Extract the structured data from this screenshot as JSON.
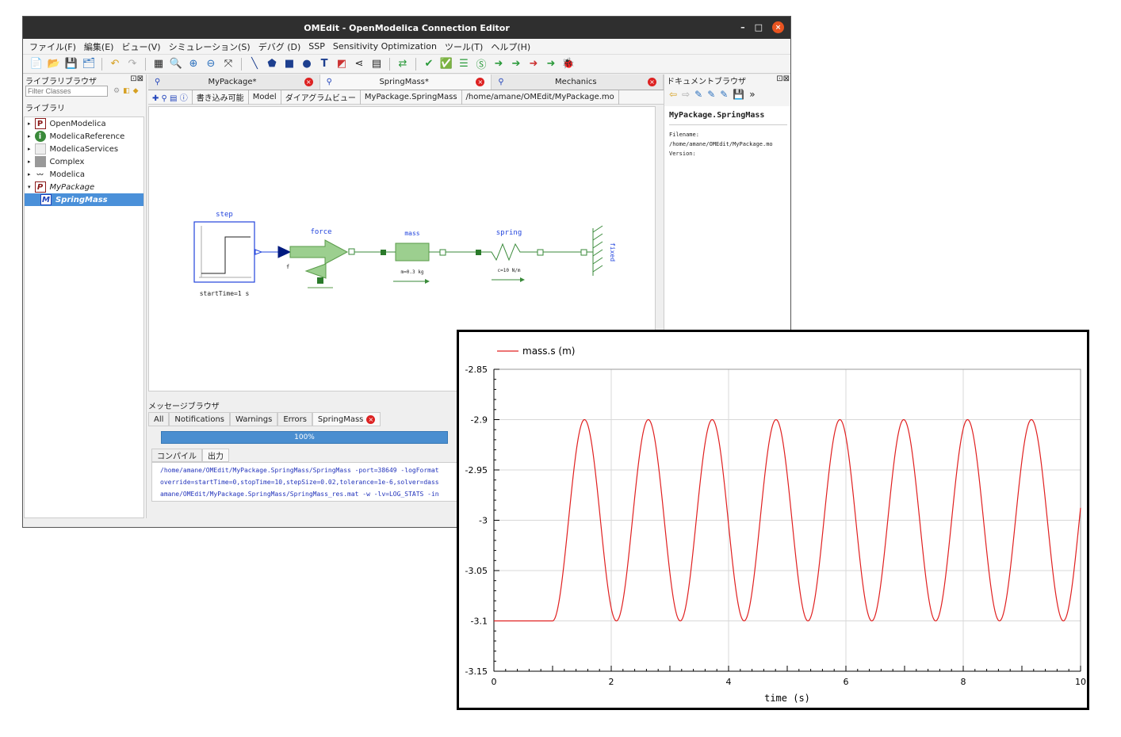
{
  "window": {
    "title": "OMEdit - OpenModelica Connection Editor",
    "min": "–",
    "max": "□",
    "close": "×"
  },
  "menu": [
    "ファイル(F)",
    "編集(E)",
    "ビュー(V)",
    "シミュレーション(S)",
    "デバグ (D)",
    "SSP",
    "Sensitivity Optimization",
    "ツール(T)",
    "ヘルプ(H)"
  ],
  "library": {
    "header": "ライブラリブラウザ",
    "filter_placeholder": "Filter Classes",
    "section": "ライブラリ",
    "items": [
      {
        "label": "OpenModelica",
        "icon": "package-P-icon"
      },
      {
        "label": "ModelicaReference",
        "icon": "info-icon"
      },
      {
        "label": "ModelicaServices",
        "icon": "blank-package-icon"
      },
      {
        "label": "Complex",
        "icon": "gray-package-icon"
      },
      {
        "label": "Modelica",
        "icon": "modelica-icon"
      },
      {
        "label": "MyPackage",
        "icon": "package-P-icon"
      },
      {
        "label": "SpringMass",
        "icon": "model-M-icon"
      }
    ]
  },
  "tabs": [
    "MyPackage*",
    "SpringMass*",
    "Mechanics"
  ],
  "modelbar": [
    "書き込み可能",
    "Model",
    "ダイアグラムビュー",
    "MyPackage.SpringMass",
    "/home/amane/OMEdit/MyPackage.mo"
  ],
  "diagram": {
    "step": "step",
    "step_param": "startTime=1 s",
    "force": "force",
    "force_port": "f",
    "mass": "mass",
    "mass_param": "m=0.3 kg",
    "spring": "spring",
    "spring_param": "c=10 N/m",
    "fixed": "fixed"
  },
  "messages": {
    "header": "メッセージブラウザ",
    "tabs": [
      "All",
      "Notifications",
      "Warnings",
      "Errors",
      "SpringMass"
    ],
    "progress": "100%",
    "subtabs": [
      "コンパイル",
      "出力"
    ],
    "output": [
      "/home/amane/OMEdit/MyPackage.SpringMass/SpringMass -port=38649 -logFormat",
      "override=startTime=0,stopTime=10,stepSize=0.02,tolerance=1e-6,solver=dass",
      "amane/OMEdit/MyPackage.SpringMass/SpringMass_res.mat -w -lv=LOG_STATS -in"
    ]
  },
  "document": {
    "header": "ドキュメントブラウザ",
    "name": "MyPackage.SpringMass",
    "filename_label": "Filename:",
    "filename": "/home/amane/OMEdit/MyPackage.mo",
    "version_label": "Version:"
  },
  "chart_data": {
    "type": "line",
    "series": [
      {
        "name": "mass.s (m)",
        "color": "#e02020"
      }
    ],
    "xlabel": "time (s)",
    "xlim": [
      0,
      10
    ],
    "ylim": [
      -3.15,
      -2.85
    ],
    "xticks": [
      0,
      2,
      4,
      6,
      8,
      10
    ],
    "yticks": [
      -2.85,
      -2.9,
      -2.95,
      -3,
      -3.05,
      -3.1,
      -3.15
    ],
    "ytick_labels": [
      "-2.85",
      "-2.9",
      "-2.95",
      "-3",
      "-3.05",
      "-3.1",
      "-3.15"
    ],
    "grid": true,
    "model": {
      "s0": -3.1,
      "step_time": 1,
      "amplitude": 0.1,
      "center": -3.0,
      "period": 1.0883,
      "mode": "1-cos"
    }
  }
}
